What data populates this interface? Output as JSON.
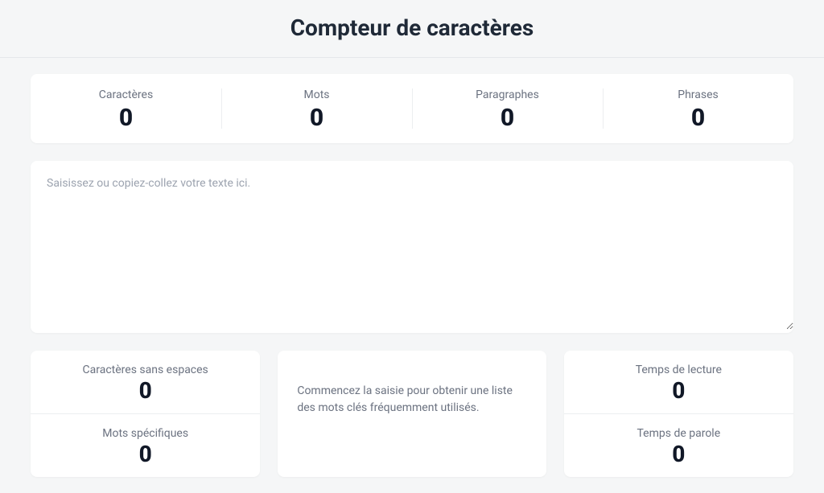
{
  "header": {
    "title": "Compteur de caractères"
  },
  "stats": {
    "characters": {
      "label": "Caractères",
      "value": "0"
    },
    "words": {
      "label": "Mots",
      "value": "0"
    },
    "paragraphs": {
      "label": "Paragraphes",
      "value": "0"
    },
    "sentences": {
      "label": "Phrases",
      "value": "0"
    }
  },
  "textarea": {
    "placeholder": "Saisissez ou copiez-collez votre texte ici.",
    "value": ""
  },
  "bottom": {
    "left": {
      "chars_no_spaces": {
        "label": "Caractères sans espaces",
        "value": "0"
      },
      "specific_words": {
        "label": "Mots spécifiques",
        "value": "0"
      }
    },
    "middle": {
      "hint": "Commencez la saisie pour obtenir une liste des mots clés fréquemment utilisés."
    },
    "right": {
      "reading_time": {
        "label": "Temps de lecture",
        "value": "0"
      },
      "speech_time": {
        "label": "Temps de parole",
        "value": "0"
      }
    }
  }
}
